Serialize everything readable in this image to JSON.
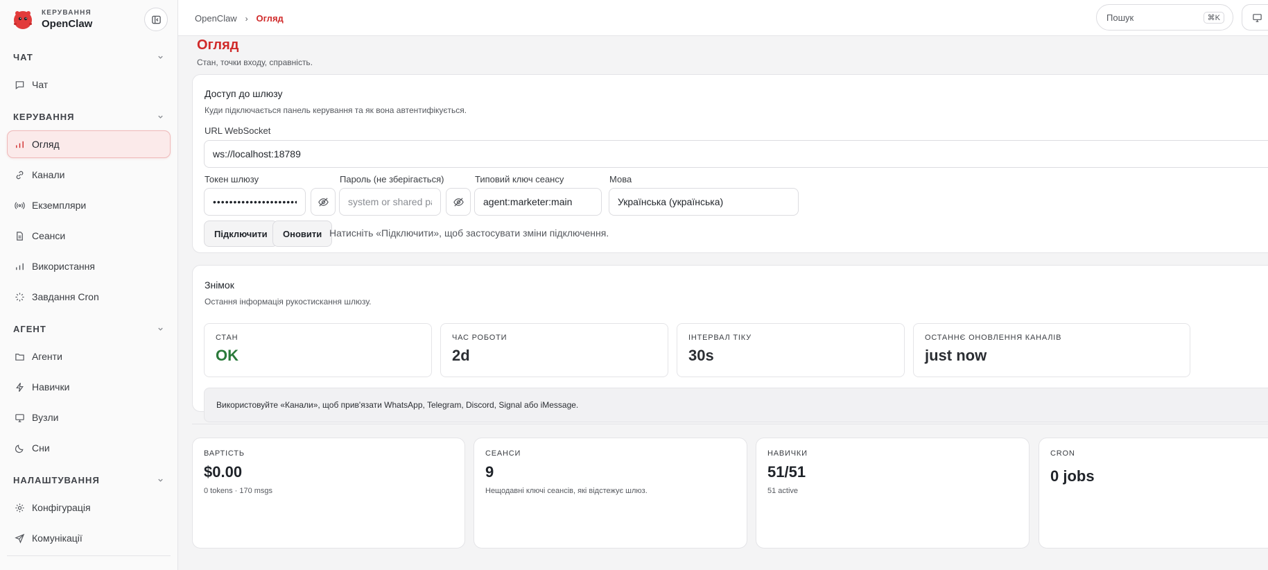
{
  "brand": {
    "kicker": "КЕРУВАННЯ",
    "name": "OpenClaw"
  },
  "sidebar": {
    "sections": [
      {
        "title": "ЧАТ",
        "items": [
          {
            "label": "Чат",
            "icon": "chat-icon"
          }
        ]
      },
      {
        "title": "КЕРУВАННЯ",
        "items": [
          {
            "label": "Огляд",
            "icon": "bar-chart-icon",
            "active": true
          },
          {
            "label": "Канали",
            "icon": "link-icon"
          },
          {
            "label": "Екземпляри",
            "icon": "broadcast-icon"
          },
          {
            "label": "Сеанси",
            "icon": "document-icon"
          },
          {
            "label": "Використання",
            "icon": "bar-chart-icon"
          },
          {
            "label": "Завдання Cron",
            "icon": "loader-icon"
          }
        ]
      },
      {
        "title": "АГЕНТ",
        "items": [
          {
            "label": "Агенти",
            "icon": "folder-icon"
          },
          {
            "label": "Навички",
            "icon": "bolt-icon"
          },
          {
            "label": "Вузли",
            "icon": "monitor-icon"
          },
          {
            "label": "Сни",
            "icon": "moon-icon"
          }
        ]
      },
      {
        "title": "НАЛАШТУВАННЯ",
        "items": [
          {
            "label": "Конфігурація",
            "icon": "gear-icon"
          },
          {
            "label": "Комунікації",
            "icon": "send-icon"
          }
        ]
      }
    ]
  },
  "topbar": {
    "breadcrumb_root": "OpenClaw",
    "breadcrumb_sep": "›",
    "breadcrumb_current": "Огляд",
    "search_placeholder": "Пошук",
    "search_shortcut": "⌘K"
  },
  "page": {
    "title": "Огляд",
    "subtitle": "Стан, точки входу, справність."
  },
  "gateway_access": {
    "title": "Доступ до шлюзу",
    "subtitle": "Куди підключається панель керування та як вона автентифікується.",
    "ws_label": "URL WebSocket",
    "ws_value": "ws://localhost:18789",
    "token_label": "Токен шлюзу",
    "token_value": "••••••••••••••••••••••••••••••••",
    "password_label": "Пароль (не зберігається)",
    "password_placeholder": "system or shared password",
    "session_key_label": "Типовий ключ сеансу",
    "session_key_value": "agent:marketer:main",
    "language_label": "Мова",
    "language_value": "Українська (українська)",
    "connect_button": "Підключити",
    "refresh_button": "Оновити",
    "hint": "Натисніть «Підключити», щоб застосувати зміни підключення."
  },
  "snapshot": {
    "title": "Знімок",
    "subtitle": "Остання інформація рукостискання шлюзу.",
    "stats": [
      {
        "label": "СТАН",
        "value": "OK",
        "status_color": "#2a7a3a"
      },
      {
        "label": "ЧАС РОБОТИ",
        "value": "2d"
      },
      {
        "label": "ІНТЕРВАЛ ТІКУ",
        "value": "30s"
      },
      {
        "label": "ОСТАННЄ ОНОВЛЕННЯ КАНАЛІВ",
        "value": "just now"
      }
    ],
    "note": "Використовуйте «Канали», щоб прив'язати WhatsApp, Telegram, Discord, Signal або iMessage."
  },
  "metrics": [
    {
      "label": "ВАРТІСТЬ",
      "value": "$0.00",
      "sub": "0 tokens · 170 msgs"
    },
    {
      "label": "СЕАНСИ",
      "value": "9",
      "sub": "Нещодавні ключі сеансів, які відстежує шлюз."
    },
    {
      "label": "НАВИЧКИ",
      "value": "51/51",
      "sub": "51 active"
    },
    {
      "label": "CRON",
      "value": "0 jobs",
      "sub": ""
    }
  ],
  "colors": {
    "accent": "#d02a2a",
    "ok": "#2a7a3a",
    "active_bg": "#fbeaea"
  }
}
